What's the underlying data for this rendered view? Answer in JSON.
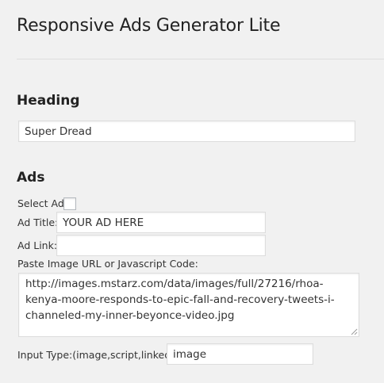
{
  "page": {
    "title": "Responsive Ads Generator Lite"
  },
  "heading_section": {
    "title": "Heading",
    "value": "Super Dread"
  },
  "ads_section": {
    "title": "Ads",
    "select_ad_label": "Select Ad:",
    "select_ad_checked": false,
    "ad_title_label": "Ad Title:",
    "ad_title_value": "YOUR AD HERE",
    "ad_link_label": "Ad Link:",
    "ad_link_value": "",
    "image_code_label": "Paste Image URL or Javascript Code:",
    "image_code_value": "http://images.mstarz.com/data/images/full/27216/rhoa-kenya-moore-responds-to-epic-fall-and-recovery-tweets-i-channeled-my-inner-beyonce-video.jpg",
    "input_type_label": "Input Type:(image,script,linked)",
    "input_type_value": "image"
  }
}
